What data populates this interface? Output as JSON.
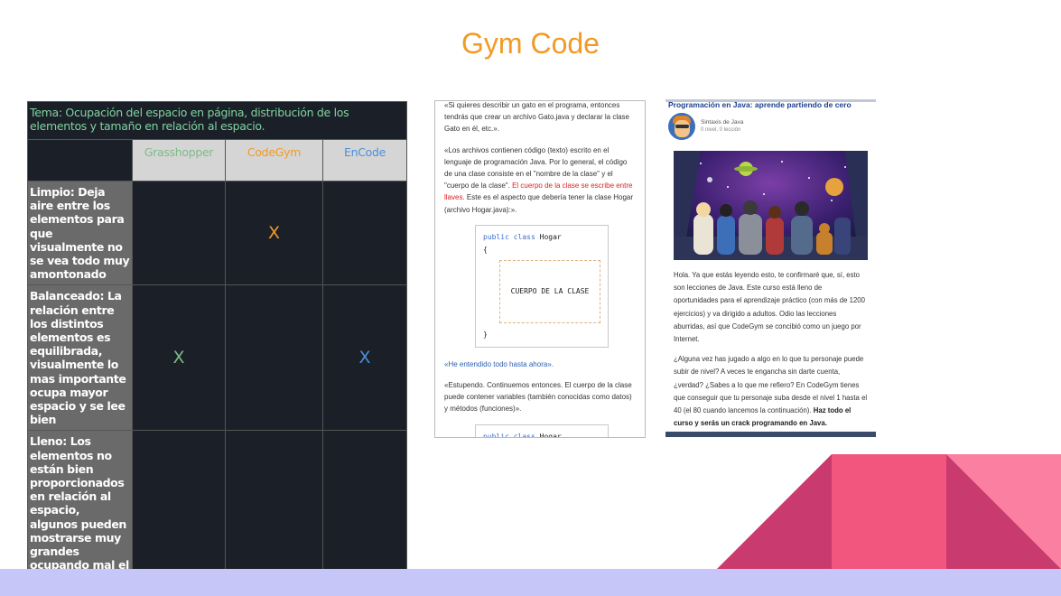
{
  "slide": {
    "title": "Gym Code"
  },
  "comparison": {
    "topic": "Tema: Ocupación del espacio en página, distribución de los elementos y tamaño en relación al espacio.",
    "headers": [
      "Grasshopper",
      "CodeGym",
      "EnCode"
    ],
    "rows": [
      {
        "criterion": "Limpio:  Deja aire entre los elementos para que visualmente no se vea todo muy amontonado",
        "marks": [
          "",
          "X",
          ""
        ]
      },
      {
        "criterion": "Balanceado:  La relación entre los distintos elementos es equilibrada, visualmente lo mas importante ocupa mayor espacio y se lee bien",
        "marks": [
          "X",
          "",
          "X"
        ]
      },
      {
        "criterion": "Lleno:  Los elementos no están bien proporcionados en relación al espacio, algunos pueden mostrarse muy grandes ocupando mal el espacio.",
        "marks": [
          "",
          "",
          ""
        ]
      }
    ]
  },
  "lesson_screenshot": {
    "p1": "«Si quieres describir un gato en el programa, entonces tendrás que crear un archivo Gato.java y declarar la clase Gato en él, etc.».",
    "p2_start": "«Los archivos contienen código (texto) escrito en el lenguaje de programación Java. Por lo general, el código de una clase consiste en el \"nombre de la clase\" y el \"cuerpo de la clase\". ",
    "p2_red": "El cuerpo de la clase se escribe entre llaves.",
    "p2_end": " Este es el aspecto que debería tener la clase Hogar (archivo Hogar.java):».",
    "code_kw1": "public",
    "code_kw2": "class",
    "code_name": "Hogar",
    "brace_open": "{",
    "brace_close": "}",
    "body_label": "CUERPO DE LA CLASE",
    "link": "«He entendido todo hasta ahora».",
    "p3": "«Estupendo. Continuemos entonces. El cuerpo de la clase puede contener variables (también conocidas como datos) y métodos (funciones)»."
  },
  "course_screenshot": {
    "title": "Programación en Java: aprende partiendo de cero",
    "author": "Sintaxis de Java",
    "author_meta": "0 nivel, 0 lección",
    "p1": "Hola. Ya que estás leyendo esto, te confirmaré que, sí, esto son lecciones de Java. Este curso está lleno de oportunidades para el aprendizaje práctico (con más de 1200 ejercicios) y va dirigido a adultos. Odio las lecciones aburridas, así que CodeGym se concibió como un juego por Internet.",
    "p2_start": "¿Alguna vez has jugado a algo en lo que tu personaje puede subir de nivel? A veces te engancha sin darte cuenta, ¿verdad? ¿Sabes a lo que me refiero? En CodeGym tienes que conseguir que tu personaje suba desde el nivel 1 hasta el 40 (el 80 cuando lancemos la continuación). ",
    "p2_bold": "Haz todo el curso y serás un crack programando en Java."
  },
  "colors": {
    "title": "#f29a25",
    "grasshopper": "#7dbb8a",
    "codegym": "#f29a25",
    "encode": "#4d8ed8",
    "table_dark": "#1b1f27",
    "band": "#c7c6f8"
  }
}
